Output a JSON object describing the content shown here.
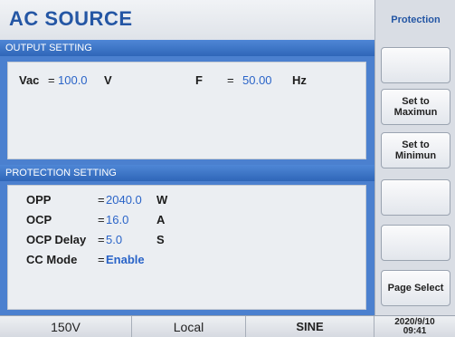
{
  "header": {
    "title": "AC SOURCE"
  },
  "output_setting": {
    "section_title": "OUTPUT SETTING",
    "vac_label": "Vac",
    "vac_eq": "=",
    "vac_value": "100.0",
    "vac_unit": "V",
    "freq_label": "F",
    "freq_eq": "=",
    "freq_value": "50.00",
    "freq_unit": "Hz"
  },
  "protection_setting": {
    "section_title": "PROTECTION SETTING",
    "rows": [
      {
        "label": "OPP",
        "eq": "=",
        "value": "2040.0",
        "unit": "W"
      },
      {
        "label": "OCP",
        "eq": "=",
        "value": "16.0",
        "unit": "A"
      },
      {
        "label": "OCP Delay",
        "eq": "=",
        "value": "5.0",
        "unit": "S"
      },
      {
        "label": "CC Mode",
        "eq": "=",
        "value": "Enable",
        "unit": ""
      }
    ]
  },
  "softkeys": {
    "title": "Protection",
    "keys": [
      "",
      "Set to\nMaximun",
      "Set to\nMinimun",
      "",
      "",
      "Page Select"
    ]
  },
  "status_bar": {
    "range": "150V",
    "mode": "Local",
    "waveform": "SINE",
    "date": "2020/9/10",
    "time": "09:41"
  }
}
